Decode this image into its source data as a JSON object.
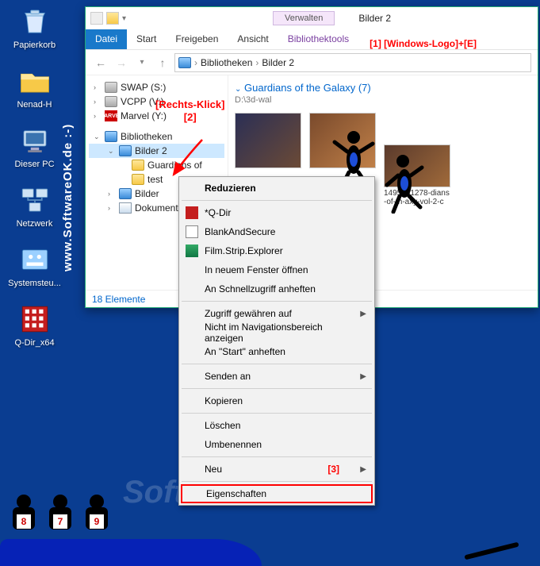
{
  "desktop": {
    "icons": [
      {
        "label": "Papierkorb"
      },
      {
        "label": "Nenad-H"
      },
      {
        "label": "Dieser PC"
      },
      {
        "label": "Netzwerk"
      },
      {
        "label": "Systemsteu..."
      },
      {
        "label": "Q-Dir_x64"
      }
    ]
  },
  "watermark": "www.SoftwareOK.de  :-)",
  "watermark_bg": "SoftwareOK.de",
  "explorer": {
    "manage_label": "Verwalten",
    "title": "Bilder 2",
    "tabs": {
      "file": "Datei",
      "start": "Start",
      "share": "Freigeben",
      "view": "Ansicht",
      "tools": "Bibliothektools"
    },
    "annotation1": "[1] [Windows-Logo]+[E]",
    "breadcrumb": {
      "root": "Bibliotheken",
      "current": "Bilder 2"
    },
    "tree": {
      "drives": [
        {
          "label": "SWAP (S:)"
        },
        {
          "label": "VCPP (V:)"
        },
        {
          "label": "Marvel (Y:)"
        }
      ],
      "lib_root": "Bibliotheken",
      "lib_sel": "Bilder 2",
      "lib_children": [
        {
          "label": "Guardians of"
        },
        {
          "label": "test"
        }
      ],
      "siblings": [
        {
          "label": "Bilder"
        },
        {
          "label": "Dokumente"
        }
      ],
      "status": "18 Elemente"
    },
    "content": {
      "group_title": "Guardians of the Galaxy (7)",
      "group_path": "D:\\3d-wal",
      "thumb_caption": "1495551278-dians-of-th-axy-vol-2-c"
    }
  },
  "annotation2": {
    "line1": "[Rechts-Klick]",
    "line2": "[2]"
  },
  "context_menu": {
    "items": [
      {
        "label": "Reduzieren",
        "bold": true
      },
      {
        "sep": true
      },
      {
        "label": "*Q-Dir",
        "icon": "qdir"
      },
      {
        "label": "BlankAndSecure",
        "icon": "blank"
      },
      {
        "label": "Film.Strip.Explorer",
        "icon": "film"
      },
      {
        "label": "In neuem Fenster öffnen"
      },
      {
        "label": "An Schnellzugriff anheften"
      },
      {
        "sep": true
      },
      {
        "label": "Zugriff gewähren auf",
        "sub": true
      },
      {
        "label": "Nicht im Navigationsbereich anzeigen"
      },
      {
        "label": "An \"Start\" anheften"
      },
      {
        "sep": true
      },
      {
        "label": "Senden an",
        "sub": true
      },
      {
        "sep": true
      },
      {
        "label": "Kopieren"
      },
      {
        "sep": true
      },
      {
        "label": "Löschen"
      },
      {
        "label": "Umbenennen"
      },
      {
        "sep": true
      },
      {
        "label": "Neu",
        "sub": true,
        "anno": "[3]"
      },
      {
        "sep": true
      },
      {
        "label": "Eigenschaften",
        "highlight": true
      }
    ]
  },
  "jurors": [
    "8",
    "7",
    "9"
  ]
}
